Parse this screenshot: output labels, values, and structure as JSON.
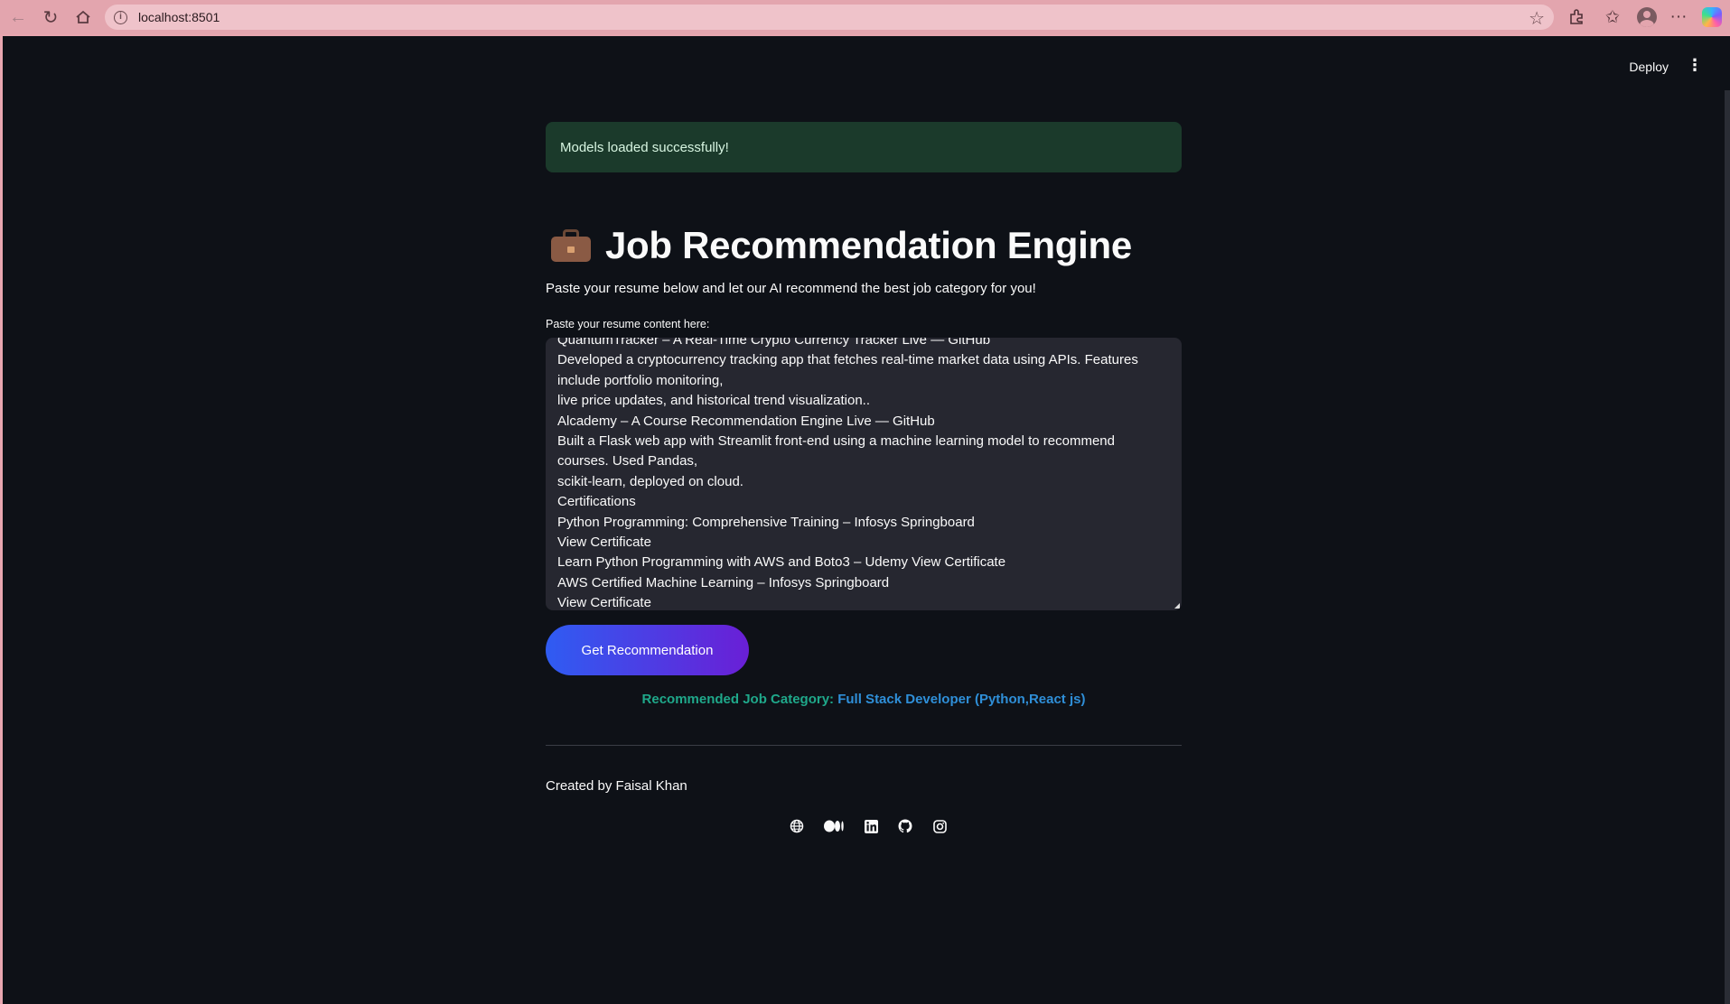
{
  "browser": {
    "url": "localhost:8501"
  },
  "header": {
    "deploy_label": "Deploy"
  },
  "alert": {
    "text": "Models loaded successfully!"
  },
  "page": {
    "title": "Job Recommendation Engine",
    "title_icon": "briefcase-icon",
    "subtitle": "Paste your resume below and let our AI recommend the best job category for you!"
  },
  "resume_input": {
    "label": "Paste your resume content here:",
    "lines": [
      "QuantumTracker – A Real-Time Crypto Currency Tracker Live — GitHub",
      "Developed a cryptocurrency tracking app that fetches real-time market data using APIs. Features",
      "include portfolio monitoring,",
      "live price updates, and historical trend visualization..",
      "Alcademy – A Course Recommendation Engine Live — GitHub",
      "Built a Flask web app with Streamlit front-end using a machine learning model to recommend",
      "courses. Used Pandas,",
      "scikit-learn, deployed on cloud.",
      "Certifications",
      "Python Programming: Comprehensive Training – Infosys Springboard",
      "View Certificate",
      "Learn Python Programming with AWS and Boto3 – Udemy View Certificate",
      "AWS Certified Machine Learning – Infosys Springboard",
      "View Certificate"
    ]
  },
  "action": {
    "button_label": "Get Recommendation"
  },
  "result": {
    "label": "Recommended Job Category: ",
    "value": "Full Stack Developer (Python,React js)"
  },
  "footer": {
    "credits": "Created by Faisal Khan",
    "social_icons": [
      "globe-icon",
      "medium-icon",
      "linkedin-icon",
      "github-icon",
      "instagram-icon"
    ]
  },
  "colors": {
    "background": "#0e1117",
    "alert_bg": "#1b3a2b",
    "button_gradient_start": "#2f5cf2",
    "button_gradient_end": "#6a1fd6",
    "result_label": "#1fa88a",
    "result_value": "#2f8fd8",
    "browser_chrome": "#e3a5ae"
  }
}
